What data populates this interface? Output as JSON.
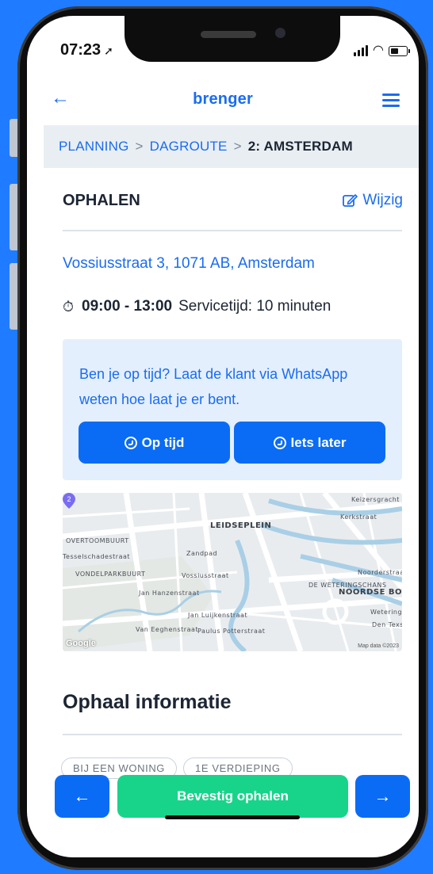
{
  "status_bar": {
    "time": "07:23",
    "location_icon": "location-arrow-icon",
    "signal_icon": "signal-bars-icon",
    "wifi_icon": "wifi-icon",
    "battery_icon": "battery-icon"
  },
  "header": {
    "back_icon": "arrow-left-icon",
    "logo": "brenger",
    "menu_icon": "hamburger-menu-icon"
  },
  "breadcrumb": {
    "items": [
      "PLANNING",
      "DAGROUTE",
      "2: AMSTERDAM"
    ],
    "separator": ">"
  },
  "section": {
    "title": "OPHALEN",
    "edit_label": "Wijzig",
    "edit_icon": "edit-icon"
  },
  "address": "Vossiusstraat 3, 1071 AB, Amsterdam",
  "timeslot": {
    "clock_icon": "stopwatch-icon",
    "window": "09:00 - 13:00",
    "service_time": "Servicetijd: 10 minuten"
  },
  "whatsapp": {
    "message": "Ben je op tijd? Laat de klant via WhatsApp weten hoe laat je er bent.",
    "on_time_label": "Op tijd",
    "later_label": "Iets later",
    "icon": "whatsapp-icon"
  },
  "map": {
    "labels": {
      "leidseplein": "LEIDSEPLEIN",
      "overtoombuurt": "OVERTOOMBUURT",
      "vondelparkbuurt": "VONDELPARKBUURT",
      "weteringschans": "DE WETERINGSCHANS",
      "noordse_bos": "NOORDSE BOS",
      "kerkstraat": "Kerkstraat",
      "zandpad": "Zandpad",
      "vossiusstraat": "Vossiusstraat",
      "jan_luijkenstraat": "Jan Luijkenstraat",
      "van_eeghenstraat": "Van Eeghenstraat",
      "paulus_potterstraat": "Paulus Potterstraat",
      "tesselschadestraat": "Tesselschadestraat",
      "wetering": "Weteringschans",
      "den_texstraat": "Den Texstraat",
      "noorderstraat": "Noorderstraat",
      "keizersgracht": "Keizersgracht",
      "jan_hanzenstraat": "Jan Hanzenstraat"
    },
    "pin_number": "2",
    "pin_color": "#7a6cf0",
    "attribution": "Google",
    "map_data": "Map data ©2023"
  },
  "info": {
    "title": "Ophaal informatie",
    "chips": [
      "BIJ EEN WONING",
      "1E VERDIEPING"
    ]
  },
  "actions": {
    "prev_icon": "arrow-left-icon",
    "confirm_label": "Bevestig ophalen",
    "next_icon": "arrow-right-icon"
  },
  "colors": {
    "brand_blue": "#1a6cf0",
    "button_blue": "#0a6cf5",
    "confirm_green": "#18d48a",
    "background": "#1f7bff"
  }
}
